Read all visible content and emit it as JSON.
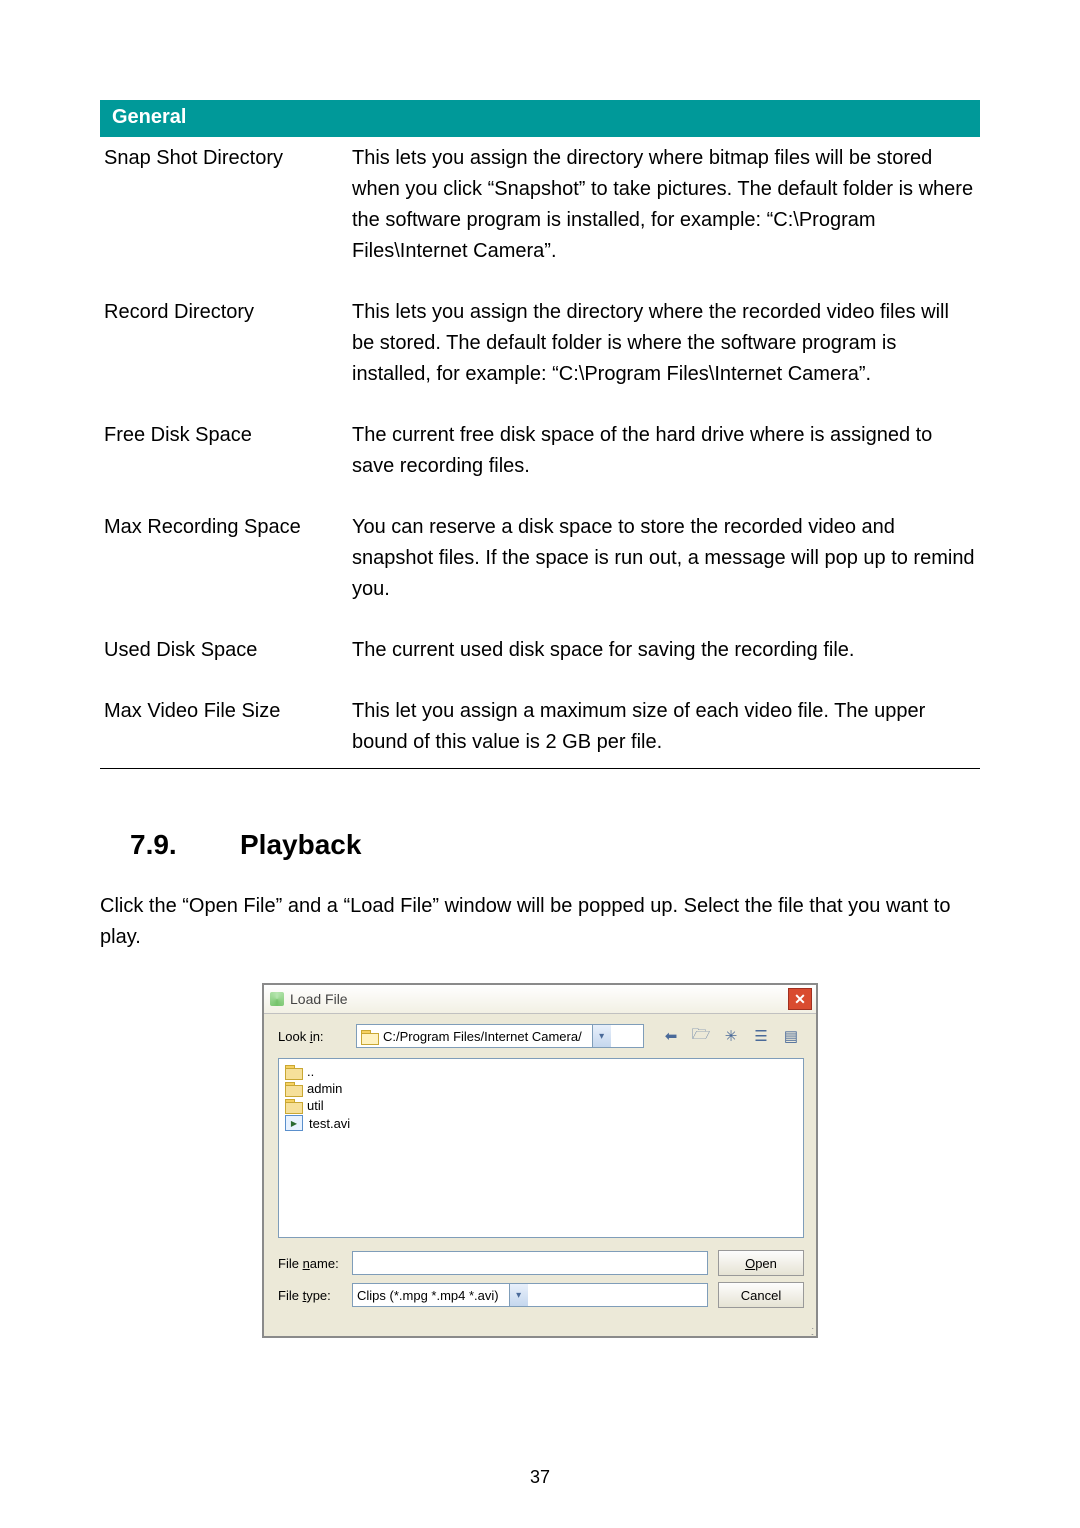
{
  "table": {
    "header": "General",
    "rows": [
      {
        "label": "Snap Shot Directory",
        "desc": "This lets you assign the directory where bitmap files will be stored when you click “Snapshot” to take pictures. The default folder is where the software program is installed, for example: “C:\\Program Files\\Internet Camera”."
      },
      {
        "label": "Record Directory",
        "desc": "This lets you assign the directory where the recorded video files will be stored. The default folder is where the software program is installed, for example: “C:\\Program Files\\Internet Camera”."
      },
      {
        "label": "Free Disk Space",
        "desc": "The current free disk space of the hard drive where is assigned to save recording files."
      },
      {
        "label": "Max Recording Space",
        "desc": "You can reserve a disk space to store the recorded video and snapshot files. If the space is run out, a message will pop up to remind you."
      },
      {
        "label": "Used Disk Space",
        "desc": "The current used disk space for saving the recording file."
      },
      {
        "label": "Max Video File Size",
        "desc": "This let you assign a maximum size of each video file. The upper bound of this value is 2 GB per file."
      }
    ]
  },
  "section": {
    "number": "7.9.",
    "title": "Playback",
    "paragraph": "Click the “Open File” and a “Load File” window will be popped up. Select the file that you want to play."
  },
  "dialog": {
    "title": "Load File",
    "look_in_label": "Look in:",
    "look_in_value": "C:/Program Files/Internet Camera/",
    "files": {
      "up": "..",
      "admin": "admin",
      "util": "util",
      "test": "test.avi"
    },
    "file_name_label": "File name:",
    "file_name_value": "",
    "file_type_label": "File type:",
    "file_type_value": "Clips (*.mpg *.mp4 *.avi)",
    "open": "Open",
    "cancel": "Cancel"
  },
  "page_number": "37"
}
